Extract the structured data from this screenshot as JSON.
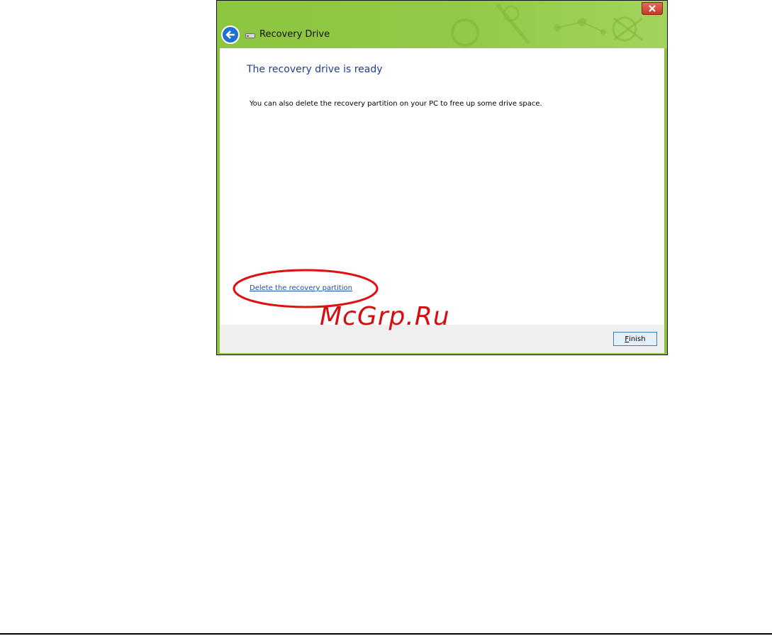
{
  "window": {
    "title": "Recovery Drive",
    "icons": {
      "back": "back-arrow-icon",
      "drive": "drive-icon",
      "close": "close-icon"
    },
    "accent_color": "#8ac43f"
  },
  "content": {
    "heading": "The recovery drive is ready",
    "description": "You can also delete the recovery partition on your PC to free up some drive space.",
    "delete_link": "Delete the recovery partition"
  },
  "footer": {
    "finish_mnemonic": "F",
    "finish_rest": "inish"
  },
  "watermark": "McGrp.Ru",
  "annotation_color": "#e01010"
}
